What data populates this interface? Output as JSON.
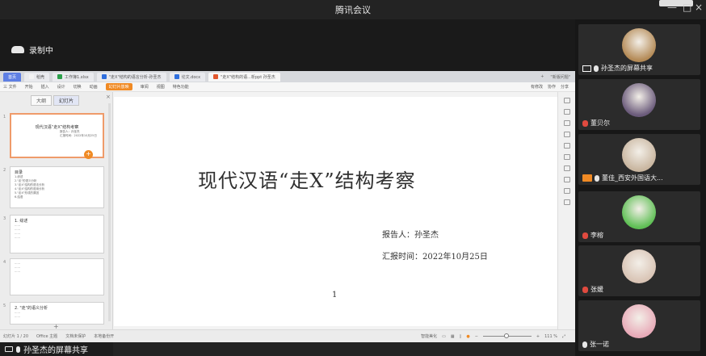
{
  "meeting": {
    "title": "腾讯会议",
    "minimize": "—",
    "maximize": "□",
    "close": "×",
    "recording_label": "录制中",
    "share_label": "孙圣杰的屏幕共享"
  },
  "wps": {
    "tabs": [
      {
        "label": "首页",
        "kind": "home"
      },
      {
        "label": "稻壳",
        "kind": "normal"
      },
      {
        "label": "工作簿1.xlsx",
        "kind": "normal"
      },
      {
        "label": "\"走X\"结构的语言分析-孙圣杰",
        "kind": "normal"
      },
      {
        "label": "论文.docx",
        "kind": "normal"
      },
      {
        "label": "\"走X\"结构的语...析ppt 孙圣杰",
        "kind": "active"
      }
    ],
    "tab_right": [
      "+",
      "\"新版问题\""
    ],
    "ribbon": [
      "三 文件",
      "开始",
      "插入",
      "设计",
      "切换",
      "动画",
      "幻灯片放映",
      "审阅",
      "视图",
      "特色功能"
    ],
    "ribbon_active": "幻灯片放映",
    "ribbon_right": [
      "有修改",
      "协作",
      "分享"
    ],
    "pane_tabs": [
      "大纲",
      "幻灯片"
    ],
    "pane_close": "×",
    "pane_add": "+",
    "thumbs": [
      {
        "no": "1",
        "title": "现代汉语“走X”结构考察",
        "lines": [
          "报告人：孙圣杰",
          "汇报时间：2022年10月25日"
        ]
      },
      {
        "no": "2",
        "title": "目录",
        "lines": [
          "1.综述",
          "2.\"走\"的语义分析",
          "3.\"走X\"结构的语法分析",
          "4.\"走X\"结构的语用分析",
          "5.\"走X\"形成的原因",
          "6.结语"
        ]
      },
      {
        "no": "3",
        "title": "1. 综述",
        "lines": [
          "……",
          "……",
          "……",
          "……"
        ]
      },
      {
        "no": "4",
        "title": "",
        "lines": [
          "……",
          "……",
          "……"
        ]
      },
      {
        "no": "5",
        "title": "2. \"走\"的语义分析",
        "lines": [
          "……",
          "……"
        ]
      }
    ],
    "slide": {
      "title": "现代汉语“走X”结构考察",
      "reporter": "报告人：孙圣杰",
      "date": "汇报时间：2022年10月25日",
      "page_no": "1"
    },
    "status": {
      "slide_pos": "幻灯片 1 / 20",
      "theme": "Office 主题",
      "backup": "文档未保护",
      "autosave": "本地备份开",
      "smart": "智能美化",
      "zoom": "111 %"
    }
  },
  "participants": [
    {
      "name": "孙圣杰的屏幕共享",
      "avatar_color": "#b48a56",
      "mic": "on",
      "tag": "screen"
    },
    {
      "name": "董贝尔",
      "avatar_color": "#6b5b7b",
      "mic": "off",
      "tag": "none"
    },
    {
      "name": "董佳_西安外国语大...",
      "avatar_color": "#c9b6a0",
      "mic": "on",
      "tag": "host"
    },
    {
      "name": "李榕",
      "avatar_color": "#5fbf55",
      "mic": "off",
      "tag": "none"
    },
    {
      "name": "张媛",
      "avatar_color": "#d9c4b5",
      "mic": "off",
      "tag": "none"
    },
    {
      "name": "张一诺",
      "avatar_color": "#e8aab8",
      "mic": "on",
      "tag": "none"
    }
  ]
}
